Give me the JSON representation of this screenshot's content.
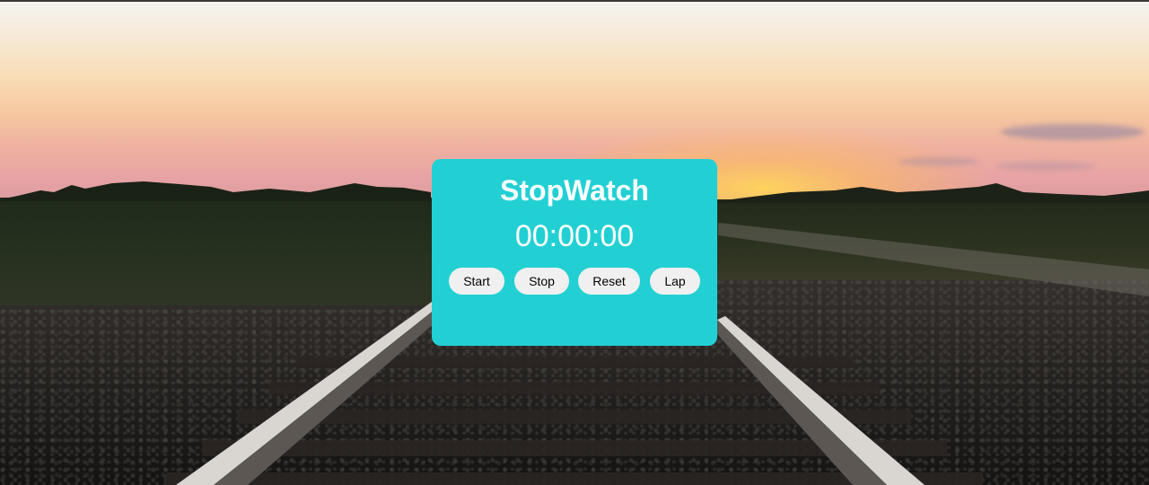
{
  "stopwatch": {
    "title": "StopWatch",
    "time": "00:00:00",
    "buttons": {
      "start": "Start",
      "stop": "Stop",
      "reset": "Reset",
      "lap": "Lap"
    }
  },
  "colors": {
    "card_background": "#22d0d4",
    "card_text": "#ffffff",
    "button_background": "#f0f0f0",
    "button_text": "#000000"
  },
  "background": {
    "scene": "sunset-railway-tracks-photo"
  }
}
